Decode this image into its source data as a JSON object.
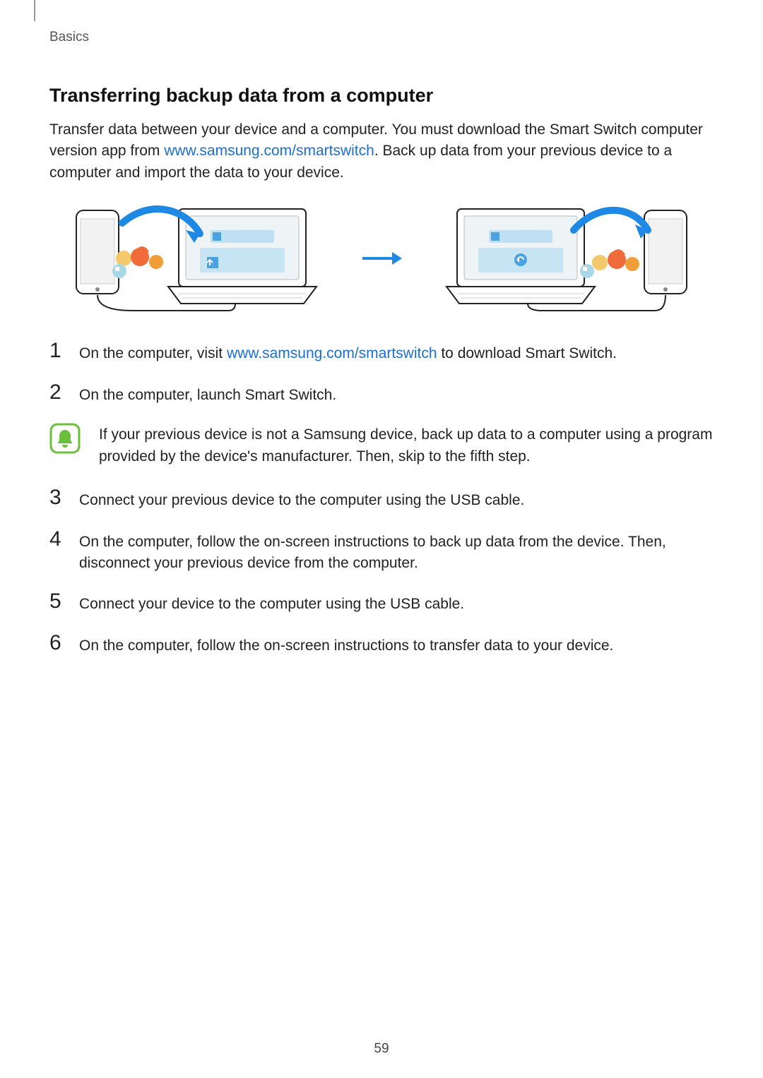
{
  "section": "Basics",
  "heading": "Transferring backup data from a computer",
  "intro": {
    "before_link": "Transfer data between your device and a computer. You must download the Smart Switch computer version app from ",
    "link_text": "www.samsung.com/smartswitch",
    "after_link": ". Back up data from your previous device to a computer and import the data to your device."
  },
  "steps": [
    {
      "num": "1",
      "before_link": "On the computer, visit ",
      "link_text": "www.samsung.com/smartswitch",
      "after_link": " to download Smart Switch."
    },
    {
      "num": "2",
      "text": "On the computer, launch Smart Switch."
    },
    {
      "num": "3",
      "text": "Connect your previous device to the computer using the USB cable."
    },
    {
      "num": "4",
      "text": "On the computer, follow the on-screen instructions to back up data from the device. Then, disconnect your previous device from the computer."
    },
    {
      "num": "5",
      "text": "Connect your device to the computer using the USB cable."
    },
    {
      "num": "6",
      "text": "On the computer, follow the on-screen instructions to transfer data to your device."
    }
  ],
  "note": "If your previous device is not a Samsung device, back up data to a computer using a program provided by the device's manufacturer. Then, skip to the fifth step.",
  "page_number": "59"
}
